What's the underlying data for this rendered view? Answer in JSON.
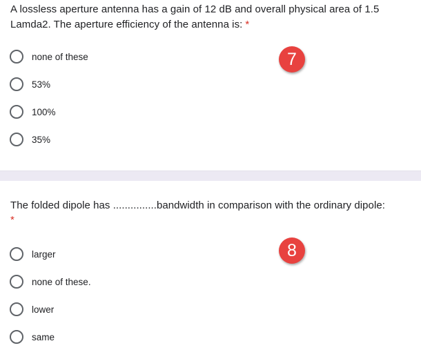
{
  "questions": [
    {
      "text": "A lossless aperture antenna has a gain of 12 dB and overall physical area of 1.5 Lamda2. The aperture efficiency of the antenna is:",
      "required_mark": "*",
      "badge": "7",
      "options": [
        "none of these",
        "53%",
        "100%",
        "35%"
      ]
    },
    {
      "text": "The folded dipole has ...............bandwidth in comparison with the ordinary dipole:",
      "required_mark": "*",
      "badge": "8",
      "options": [
        "larger",
        "none of these.",
        "lower",
        "same"
      ]
    }
  ],
  "colors": {
    "required": "#d93025",
    "badge": "#e8423f",
    "radio_border": "#5f6368",
    "separator": "#ece9f3"
  },
  "icons": {
    "radio": "radio-unchecked-icon"
  }
}
